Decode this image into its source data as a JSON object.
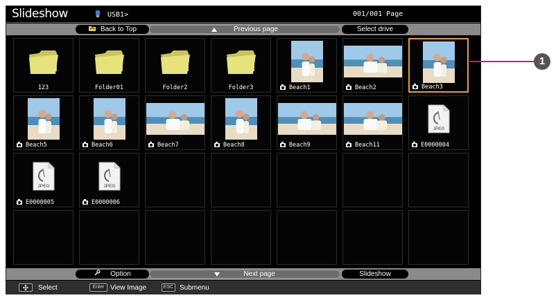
{
  "app_title": "Slideshow",
  "device_label": "USB1>",
  "page_counter": "001/001 Page",
  "top_nav": {
    "back_to_top": "Back to Top",
    "previous_page": "Previous page",
    "select_drive": "Select drive"
  },
  "bottom_nav": {
    "option": "Option",
    "next_page": "Next page",
    "slideshow": "Slideshow"
  },
  "status": {
    "select_key": "",
    "select_text": "Select",
    "enter_key": "Enter",
    "enter_text": "View Image",
    "esc_key": "ESC",
    "esc_text": "Submenu"
  },
  "callout_number": "1",
  "items": [
    {
      "name": "123",
      "kind": "folder"
    },
    {
      "name": "Folder01",
      "kind": "folder"
    },
    {
      "name": "Folder2",
      "kind": "folder"
    },
    {
      "name": "Folder3",
      "kind": "folder"
    },
    {
      "name": "Beach1",
      "kind": "photo",
      "variant": "portrait"
    },
    {
      "name": "Beach2",
      "kind": "photo",
      "variant": "landscape"
    },
    {
      "name": "Beach3",
      "kind": "photo",
      "variant": "portrait",
      "selected": true
    },
    {
      "name": "Beach5",
      "kind": "photo",
      "variant": "portrait"
    },
    {
      "name": "Beach6",
      "kind": "photo",
      "variant": "portrait"
    },
    {
      "name": "Beach7",
      "kind": "photo",
      "variant": "landscape"
    },
    {
      "name": "Beach8",
      "kind": "photo",
      "variant": "portrait"
    },
    {
      "name": "Beach9",
      "kind": "photo",
      "variant": "landscape"
    },
    {
      "name": "Beach11",
      "kind": "photo",
      "variant": "landscape"
    },
    {
      "name": "E0000004",
      "kind": "jpeg"
    },
    {
      "name": "E0000005",
      "kind": "jpeg"
    },
    {
      "name": "E0000006",
      "kind": "jpeg"
    }
  ],
  "jpeg_icon_text": "JPEG",
  "colors": {
    "selection": "#f0a020",
    "callout_line": "#d4147c",
    "folder": "#e6e37a"
  }
}
